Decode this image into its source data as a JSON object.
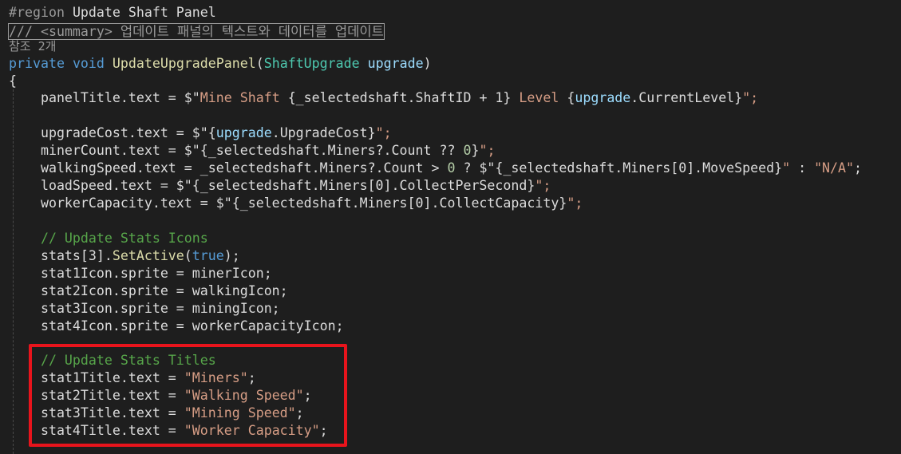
{
  "lines": {
    "l1": {
      "a": "#region ",
      "b": "Update Shaft Panel"
    },
    "l2": {
      "a": "/// ",
      "b": "<summary>",
      "c": " 업데이트 패널의 텍스트와 데이터를 업데이트"
    },
    "l3": {
      "a": "참조 2개"
    },
    "l4": {
      "a": "private",
      "b": " ",
      "c": "void",
      "d": " ",
      "e": "UpdateUpgradePanel",
      "f": "(",
      "g": "ShaftUpgrade",
      "h": " ",
      "i": "upgrade",
      "j": ")"
    },
    "l5": {
      "a": "{"
    },
    "l6": {
      "a": "    panelTitle.text = $\"",
      "b": "Mine Shaft ",
      "c": "{_selectedshaft.ShaftID + 1}",
      "d": " Level ",
      "e": "{",
      "f": "upgrade",
      "g": ".CurrentLevel}",
      "h": "\";"
    },
    "l7": {
      "a": "    upgradeCost.text = $\"",
      "b": "{",
      "c": "upgrade",
      "d": ".UpgradeCost}",
      "e": "\";"
    },
    "l8": {
      "a": "    minerCount.text = $\"",
      "b": "{_selectedshaft.Miners?.Count ?? ",
      "c": "0",
      "d": "}",
      "e": "\";"
    },
    "l9": {
      "a": "    walkingSpeed.text = _selectedshaft.Miners?.Count > ",
      "b": "0",
      "c": " ? $\"",
      "d": "{_selectedshaft.Miners[0].MoveSpeed}",
      "e": "\"",
      "f": " : ",
      "g": "\"N/A\"",
      "h": ";"
    },
    "l10": {
      "a": "    loadSpeed.text = $\"",
      "b": "{_selectedshaft.Miners[0].CollectPerSecond}",
      "c": "\";"
    },
    "l11": {
      "a": "    workerCapacity.text = $\"",
      "b": "{_selectedshaft.Miners[0].CollectCapacity}",
      "c": "\";"
    },
    "l12": {
      "a": "    // Update Stats Icons"
    },
    "l13": {
      "a": "    stats[3].",
      "b": "SetActive",
      "c": "(",
      "d": "true",
      "e": ");"
    },
    "l14": {
      "a": "    stat1Icon.sprite = minerIcon;"
    },
    "l15": {
      "a": "    stat2Icon.sprite = walkingIcon;"
    },
    "l16": {
      "a": "    stat3Icon.sprite = miningIcon;"
    },
    "l17": {
      "a": "    stat4Icon.sprite = workerCapacityIcon;"
    },
    "l18": {
      "a": "    // Update Stats Titles"
    },
    "l19": {
      "a": "    stat1Title.text = ",
      "b": "\"Miners\"",
      "c": ";"
    },
    "l20": {
      "a": "    stat2Title.text = ",
      "b": "\"Walking Speed\"",
      "c": ";"
    },
    "l21": {
      "a": "    stat3Title.text = ",
      "b": "\"Mining Speed\"",
      "c": ";"
    },
    "l22": {
      "a": "    stat4Title.text = ",
      "b": "\"Worker Capacity\"",
      "c": ";"
    }
  },
  "colors": {
    "background": "#1e1e1e",
    "keyword": "#569cd6",
    "type": "#4ec9b0",
    "method": "#dcdcaa",
    "string": "#d69d85",
    "number": "#b5cea8",
    "comment": "#57a64a",
    "variable": "#9cdcfe",
    "highlight_border": "#e8141c"
  }
}
